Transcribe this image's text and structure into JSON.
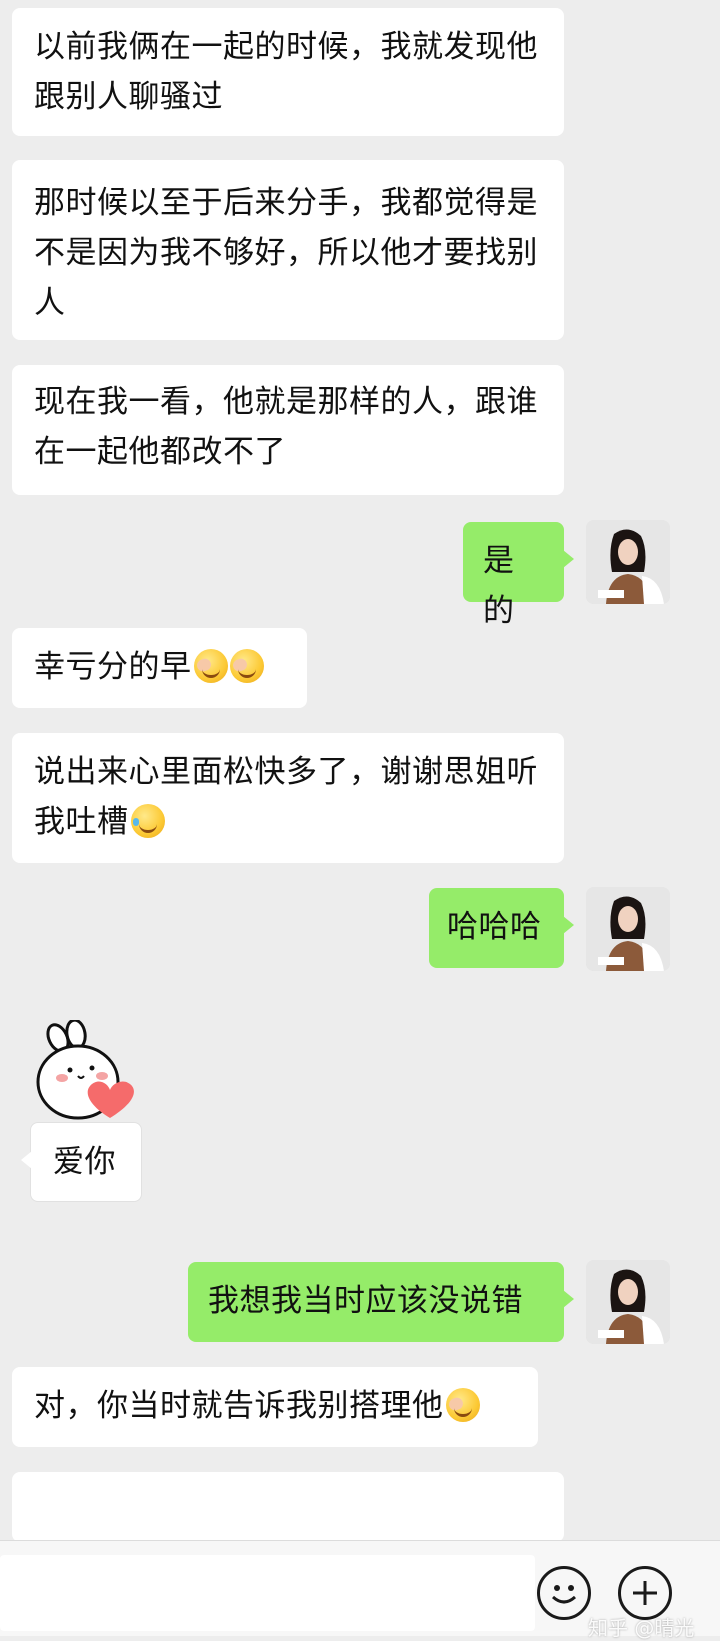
{
  "messages": [
    {
      "side": "in",
      "text": "以前我俩在一起的时候，我就发现他跟别人聊骚过"
    },
    {
      "side": "in",
      "text": "那时候以至于后来分手，我都觉得是不是因为我不够好，所以他才要找别人"
    },
    {
      "side": "in",
      "text": "现在我一看，他就是那样的人，跟谁在一起他都改不了"
    },
    {
      "side": "out",
      "text": "是的"
    },
    {
      "side": "in",
      "text": "幸亏分的早",
      "emojis": [
        "facepalm-emoji",
        "facepalm-emoji"
      ]
    },
    {
      "side": "in",
      "text": "说出来心里面松快多了，谢谢思姐听我吐槽",
      "emojis": [
        "laugh-cry-emoji"
      ]
    },
    {
      "side": "out",
      "text": "哈哈哈"
    },
    {
      "side": "in",
      "sticker": "love-you-bunny-sticker",
      "text": "爱你"
    },
    {
      "side": "out",
      "text": "我想我当时应该没说错"
    },
    {
      "side": "in",
      "text": "对，你当时就告诉我别搭理他",
      "emojis": [
        "facepalm-emoji"
      ]
    }
  ],
  "input_bar": {
    "emoji_button": "smiley-icon",
    "more_button": "plus-icon"
  },
  "watermark": "知乎 @晴光",
  "colors": {
    "outgoing_bubble": "#95ec69",
    "incoming_bubble": "#ffffff",
    "background": "#ededed"
  }
}
